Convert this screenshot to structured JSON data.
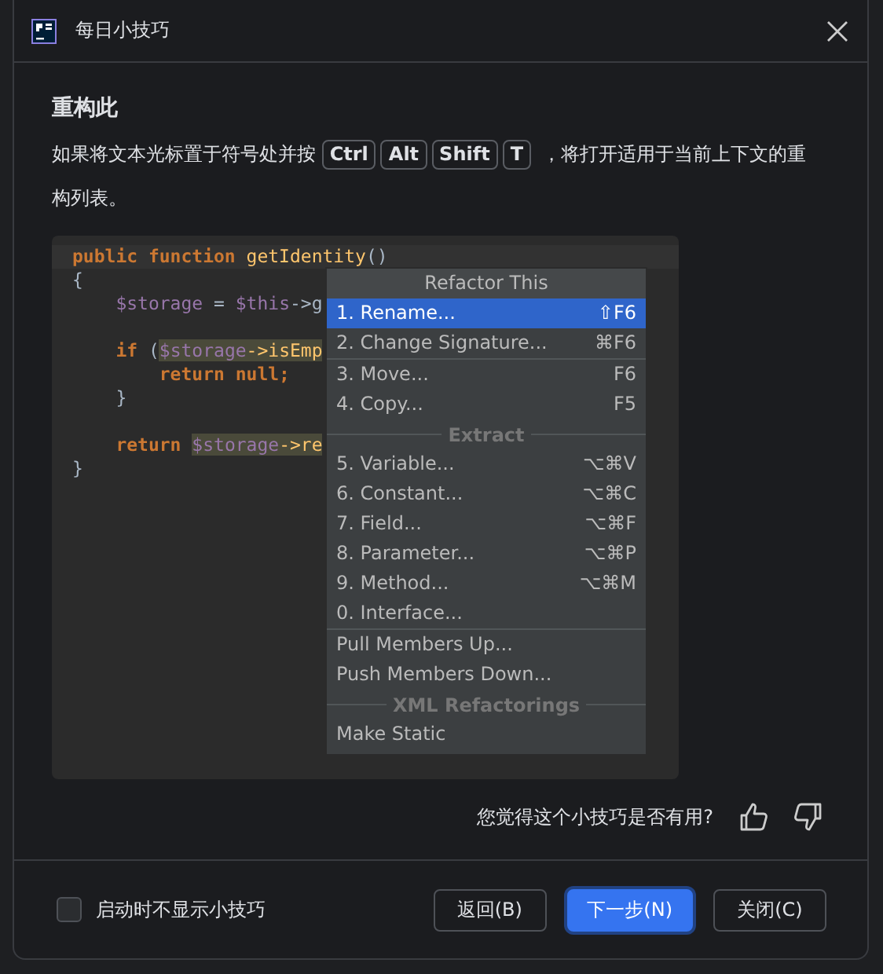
{
  "window": {
    "title": "每日小技巧"
  },
  "tip": {
    "title": "重构此",
    "text_before": "如果将文本光标置于符号处并按",
    "keys": [
      "Ctrl",
      "Alt",
      "Shift",
      "T"
    ],
    "text_after": "，将打开适用于当前上下文的重构列表。"
  },
  "code_blocks": [
    [
      [
        {
          "text": "public function ",
          "kind": "keyword"
        },
        {
          "text": "getIdentity",
          "kind": "func"
        },
        {
          "text": "()",
          "kind": "plain"
        }
      ],
      [
        {
          "text": "{",
          "kind": "plain"
        }
      ],
      [
        {
          "text": "    $storage",
          "kind": "var"
        },
        {
          "text": " = ",
          "kind": "plain"
        },
        {
          "text": "$this",
          "kind": "var"
        },
        {
          "text": "->g",
          "kind": "plain"
        }
      ]
    ],
    [
      [
        {
          "text": "    if",
          "kind": "keyword"
        },
        {
          "text": " (",
          "kind": "plain"
        },
        {
          "text": "$storage",
          "kind": "var-hl"
        },
        {
          "text": "->isEmp",
          "kind": "func-hl"
        }
      ],
      [
        {
          "text": "        return null;",
          "kind": "keyword"
        }
      ],
      [
        {
          "text": "    }",
          "kind": "plain"
        }
      ]
    ],
    [
      [
        {
          "text": "    return ",
          "kind": "keyword"
        },
        {
          "text": "$storage",
          "kind": "var-hl"
        },
        {
          "text": "->re",
          "kind": "func-hl"
        }
      ],
      [
        {
          "text": "}",
          "kind": "plain"
        }
      ]
    ]
  ],
  "menu": {
    "title": "Refactor This",
    "items": [
      {
        "kind": "item",
        "label": "1. Rename...",
        "shortcut": "⇧F6",
        "selected": true
      },
      {
        "kind": "item",
        "label": "2. Change Signature...",
        "shortcut": "⌘F6",
        "selected": false
      },
      {
        "kind": "separator"
      },
      {
        "kind": "item",
        "label": "3. Move...",
        "shortcut": "F6",
        "selected": false
      },
      {
        "kind": "item",
        "label": "4. Copy...",
        "shortcut": "F5",
        "selected": false
      },
      {
        "kind": "section",
        "label": "Extract"
      },
      {
        "kind": "item",
        "label": "5. Variable...",
        "shortcut": "⌥⌘V",
        "selected": false
      },
      {
        "kind": "item",
        "label": "6. Constant...",
        "shortcut": "⌥⌘C",
        "selected": false
      },
      {
        "kind": "item",
        "label": "7. Field...",
        "shortcut": "⌥⌘F",
        "selected": false
      },
      {
        "kind": "item",
        "label": "8. Parameter...",
        "shortcut": "⌥⌘P",
        "selected": false
      },
      {
        "kind": "item",
        "label": "9. Method...",
        "shortcut": "⌥⌘M",
        "selected": false
      },
      {
        "kind": "item",
        "label": "0. Interface...",
        "selected": false
      },
      {
        "kind": "separator"
      },
      {
        "kind": "item",
        "label": "Pull Members Up...",
        "selected": false
      },
      {
        "kind": "item",
        "label": "Push Members Down...",
        "selected": false
      },
      {
        "kind": "section",
        "label": "XML Refactorings"
      },
      {
        "kind": "item",
        "label": "Make Static",
        "selected": false
      }
    ]
  },
  "feedback": {
    "question": "您觉得这个小技巧是否有用?"
  },
  "footer": {
    "dont_show_label": "启动时不显示小技巧",
    "dont_show_checked": false,
    "buttons": [
      {
        "label": "返回(B)",
        "primary": false
      },
      {
        "label": "下一步(N)",
        "primary": true
      },
      {
        "label": "关闭(C)",
        "primary": false
      }
    ]
  }
}
